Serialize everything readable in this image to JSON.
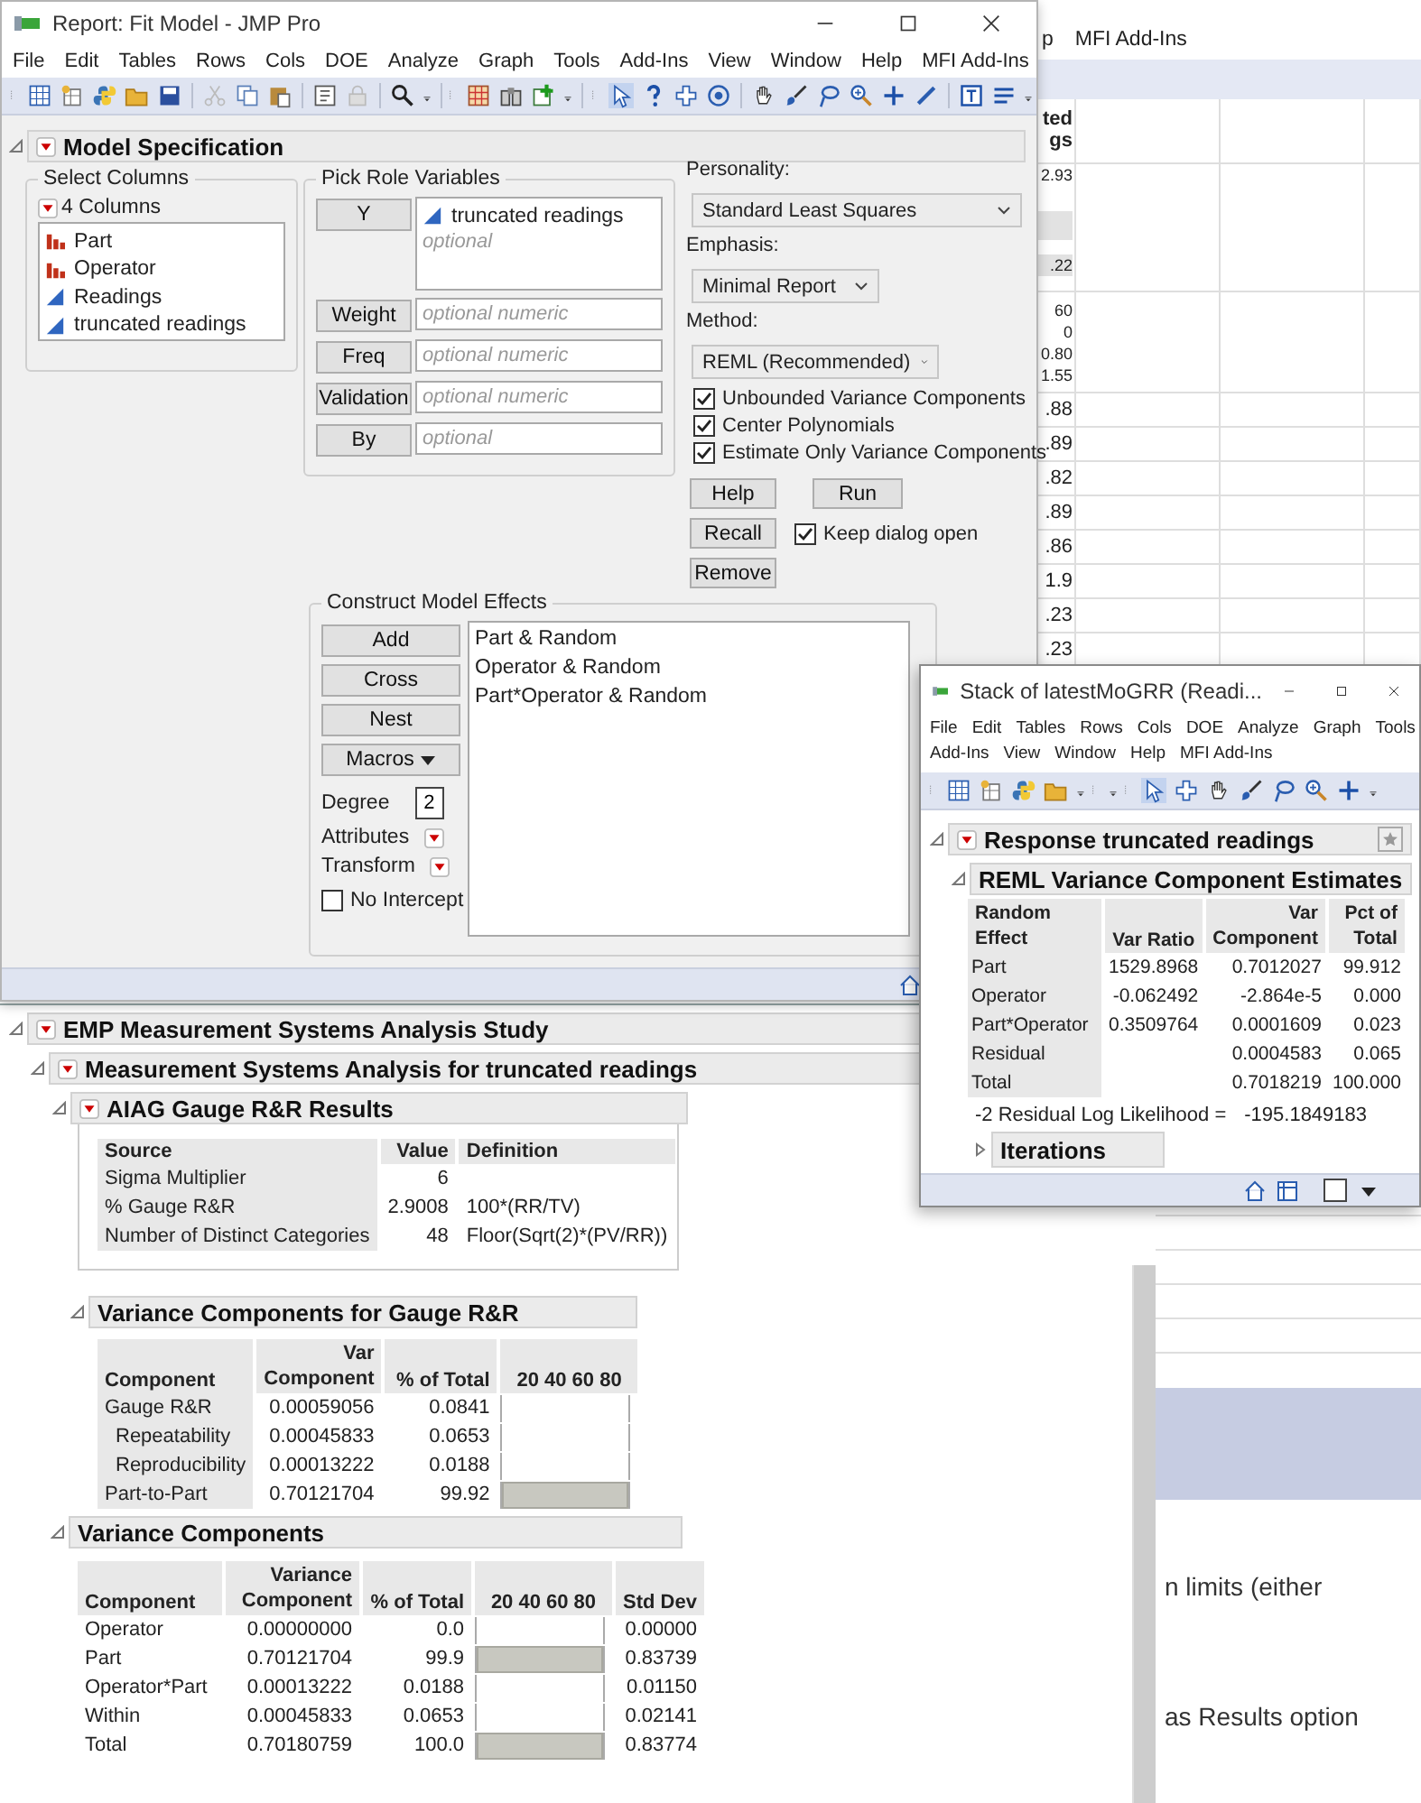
{
  "background_window": {
    "menu_fragment": "p",
    "menu_item": "MFI Add-Ins",
    "header": [
      "ted",
      "gs"
    ],
    "block_a": [
      "2.93",
      ".22"
    ],
    "block_b": [
      "60",
      "0",
      "0.80",
      "1.55"
    ],
    "rows": [
      ".88",
      ".89",
      ".82",
      ".89",
      ".86",
      "1.9",
      ".23",
      ".23"
    ],
    "notes": [
      "n limits (either",
      "as Results option"
    ]
  },
  "fit_window": {
    "title": "Report: Fit Model - JMP Pro",
    "menu": [
      "File",
      "Edit",
      "Tables",
      "Rows",
      "Cols",
      "DOE",
      "Analyze",
      "Graph",
      "Tools",
      "Add-Ins",
      "View",
      "Window",
      "Help",
      "MFI Add-Ins"
    ],
    "section": "Model Specification",
    "select_columns": {
      "legend": "Select Columns",
      "count": "4 Columns",
      "columns": [
        {
          "name": "Part",
          "kind": "nominal"
        },
        {
          "name": "Operator",
          "kind": "nominal"
        },
        {
          "name": "Readings",
          "kind": "continuous"
        },
        {
          "name": "truncated readings",
          "kind": "continuous"
        }
      ]
    },
    "pick_roles": {
      "legend": "Pick Role Variables",
      "roles": [
        {
          "button": "Y",
          "items": [
            {
              "name": "truncated readings",
              "kind": "continuous"
            }
          ],
          "placeholder": "optional"
        },
        {
          "button": "Weight",
          "placeholder": "optional numeric"
        },
        {
          "button": "Freq",
          "placeholder": "optional numeric"
        },
        {
          "button": "Validation",
          "placeholder": "optional numeric"
        },
        {
          "button": "By",
          "placeholder": "optional"
        }
      ]
    },
    "personality": {
      "label": "Personality:",
      "value": "Standard Least Squares"
    },
    "emphasis": {
      "label": "Emphasis:",
      "value": "Minimal Report"
    },
    "method": {
      "label": "Method:",
      "value": "REML (Recommended)"
    },
    "options": [
      {
        "label": "Unbounded Variance Components",
        "checked": true
      },
      {
        "label": "Center Polynomials",
        "checked": true
      },
      {
        "label": "Estimate Only Variance Components",
        "checked": true
      }
    ],
    "buttons": [
      "Help",
      "Run",
      "Recall",
      "Remove"
    ],
    "keep_open": {
      "label": "Keep dialog open",
      "checked": true
    },
    "effects": {
      "legend": "Construct Model Effects",
      "buttons": [
        "Add",
        "Cross",
        "Nest"
      ],
      "macros": "Macros",
      "degree_label": "Degree",
      "degree": "2",
      "attributes": "Attributes",
      "transform": "Transform",
      "no_intercept": {
        "label": "No Intercept",
        "checked": false
      },
      "items": [
        "Part & Random",
        "Operator & Random",
        "Part*Operator & Random"
      ]
    }
  },
  "msa_window": {
    "title": "EMP Measurement Systems Analysis Study",
    "subtitle": "Measurement Systems Analysis for truncated readings",
    "aiag": {
      "title": "AIAG Gauge R&R Results",
      "columns": [
        "Source",
        "Value",
        "Definition"
      ],
      "rows": [
        {
          "source": "Sigma Multiplier",
          "value": "6"
        },
        {
          "source": "% Gauge R&R",
          "value": "2.9008",
          "definition": "100*(RR/TV)"
        },
        {
          "source": "Number of Distinct Categories",
          "value": "48",
          "definition": "Floor(Sqrt(2)*(PV/RR))"
        }
      ]
    },
    "gauge_components": {
      "title": "Variance Components for Gauge R&R",
      "columns": [
        "Component",
        "Var Component",
        "% of Total",
        "20 40 60 80"
      ],
      "rows": [
        {
          "name": "Gauge R&R",
          "component": "0.00059056",
          "percent": "0.0841",
          "level": 0.000841,
          "children": [
            {
              "name": "Repeatability",
              "component": "0.00045833",
              "percent": "0.0653",
              "level": 0.000653
            },
            {
              "name": "Reproducibility",
              "component": "0.00013222",
              "percent": "0.0188",
              "level": 0.000188
            }
          ]
        },
        {
          "name": "Part-to-Part",
          "component": "0.70121704",
          "percent": "99.92",
          "level": 0.9992
        }
      ]
    },
    "variance_components": {
      "title": "Variance Components",
      "columns": [
        "Component",
        "Variance Component",
        "% of Total",
        "20 40 60 80",
        "Std Dev"
      ],
      "rows": [
        {
          "name": "Operator",
          "component": "0.00000000",
          "percent": "0.0",
          "level": 0,
          "std": "0.00000"
        },
        {
          "name": "Part",
          "component": "0.70121704",
          "percent": "99.9",
          "level": 0.999,
          "std": "0.83739"
        },
        {
          "name": "Operator*Part",
          "component": "0.00013222",
          "percent": "0.0188",
          "level": 0.000188,
          "std": "0.01150"
        },
        {
          "name": "Within",
          "component": "0.00045833",
          "percent": "0.0653",
          "level": 0.000653,
          "std": "0.02141"
        },
        {
          "name": "Total",
          "component": "0.70180759",
          "percent": "100.0",
          "level": 1,
          "std": "0.83774"
        }
      ]
    }
  },
  "stack_window": {
    "title": "Stack of latestMoGRR (Readi...",
    "menu": [
      "File",
      "Edit",
      "Tables",
      "Rows",
      "Cols",
      "DOE",
      "Analyze",
      "Graph",
      "Tools",
      "Add-Ins",
      "View",
      "Window",
      "Help",
      "MFI Add-Ins"
    ],
    "response": "Response truncated readings",
    "reml_title": "REML Variance Component Estimates",
    "columns": [
      "Random Effect",
      "Var Ratio",
      "Var Component",
      "Pct of Total"
    ],
    "rows": [
      {
        "effect": "Part",
        "ratio": "1529.8968",
        "component": "0.7012027",
        "pct": "99.912"
      },
      {
        "effect": "Operator",
        "ratio": "-0.062492",
        "component": "-2.864e-5",
        "pct": "0.000"
      },
      {
        "effect": "Part*Operator",
        "ratio": "0.3509764",
        "component": "0.0001609",
        "pct": "0.023"
      },
      {
        "effect": "Residual",
        "component": "0.0004583",
        "pct": "0.065"
      },
      {
        "effect": "Total",
        "component": "0.7018219",
        "pct": "100.000"
      }
    ],
    "likelihood_label": "-2 Residual Log Likelihood =",
    "likelihood": "-195.1849183",
    "iterations": "Iterations"
  }
}
